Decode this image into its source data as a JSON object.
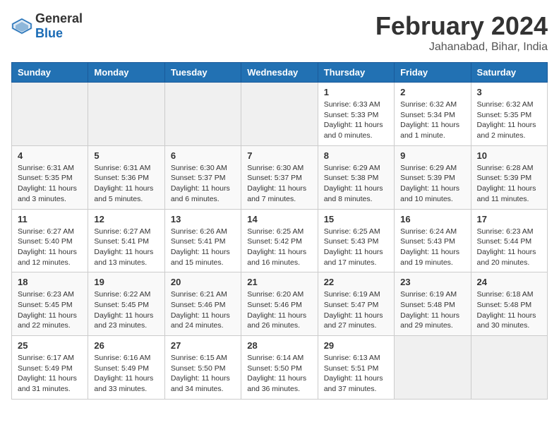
{
  "logo": {
    "general": "General",
    "blue": "Blue"
  },
  "title": {
    "month_year": "February 2024",
    "location": "Jahanabad, Bihar, India"
  },
  "weekdays": [
    "Sunday",
    "Monday",
    "Tuesday",
    "Wednesday",
    "Thursday",
    "Friday",
    "Saturday"
  ],
  "weeks": [
    [
      {
        "day": "",
        "info": ""
      },
      {
        "day": "",
        "info": ""
      },
      {
        "day": "",
        "info": ""
      },
      {
        "day": "",
        "info": ""
      },
      {
        "day": "1",
        "info": "Sunrise: 6:33 AM\nSunset: 5:33 PM\nDaylight: 11 hours\nand 0 minutes."
      },
      {
        "day": "2",
        "info": "Sunrise: 6:32 AM\nSunset: 5:34 PM\nDaylight: 11 hours\nand 1 minute."
      },
      {
        "day": "3",
        "info": "Sunrise: 6:32 AM\nSunset: 5:35 PM\nDaylight: 11 hours\nand 2 minutes."
      }
    ],
    [
      {
        "day": "4",
        "info": "Sunrise: 6:31 AM\nSunset: 5:35 PM\nDaylight: 11 hours\nand 3 minutes."
      },
      {
        "day": "5",
        "info": "Sunrise: 6:31 AM\nSunset: 5:36 PM\nDaylight: 11 hours\nand 5 minutes."
      },
      {
        "day": "6",
        "info": "Sunrise: 6:30 AM\nSunset: 5:37 PM\nDaylight: 11 hours\nand 6 minutes."
      },
      {
        "day": "7",
        "info": "Sunrise: 6:30 AM\nSunset: 5:37 PM\nDaylight: 11 hours\nand 7 minutes."
      },
      {
        "day": "8",
        "info": "Sunrise: 6:29 AM\nSunset: 5:38 PM\nDaylight: 11 hours\nand 8 minutes."
      },
      {
        "day": "9",
        "info": "Sunrise: 6:29 AM\nSunset: 5:39 PM\nDaylight: 11 hours\nand 10 minutes."
      },
      {
        "day": "10",
        "info": "Sunrise: 6:28 AM\nSunset: 5:39 PM\nDaylight: 11 hours\nand 11 minutes."
      }
    ],
    [
      {
        "day": "11",
        "info": "Sunrise: 6:27 AM\nSunset: 5:40 PM\nDaylight: 11 hours\nand 12 minutes."
      },
      {
        "day": "12",
        "info": "Sunrise: 6:27 AM\nSunset: 5:41 PM\nDaylight: 11 hours\nand 13 minutes."
      },
      {
        "day": "13",
        "info": "Sunrise: 6:26 AM\nSunset: 5:41 PM\nDaylight: 11 hours\nand 15 minutes."
      },
      {
        "day": "14",
        "info": "Sunrise: 6:25 AM\nSunset: 5:42 PM\nDaylight: 11 hours\nand 16 minutes."
      },
      {
        "day": "15",
        "info": "Sunrise: 6:25 AM\nSunset: 5:43 PM\nDaylight: 11 hours\nand 17 minutes."
      },
      {
        "day": "16",
        "info": "Sunrise: 6:24 AM\nSunset: 5:43 PM\nDaylight: 11 hours\nand 19 minutes."
      },
      {
        "day": "17",
        "info": "Sunrise: 6:23 AM\nSunset: 5:44 PM\nDaylight: 11 hours\nand 20 minutes."
      }
    ],
    [
      {
        "day": "18",
        "info": "Sunrise: 6:23 AM\nSunset: 5:45 PM\nDaylight: 11 hours\nand 22 minutes."
      },
      {
        "day": "19",
        "info": "Sunrise: 6:22 AM\nSunset: 5:45 PM\nDaylight: 11 hours\nand 23 minutes."
      },
      {
        "day": "20",
        "info": "Sunrise: 6:21 AM\nSunset: 5:46 PM\nDaylight: 11 hours\nand 24 minutes."
      },
      {
        "day": "21",
        "info": "Sunrise: 6:20 AM\nSunset: 5:46 PM\nDaylight: 11 hours\nand 26 minutes."
      },
      {
        "day": "22",
        "info": "Sunrise: 6:19 AM\nSunset: 5:47 PM\nDaylight: 11 hours\nand 27 minutes."
      },
      {
        "day": "23",
        "info": "Sunrise: 6:19 AM\nSunset: 5:48 PM\nDaylight: 11 hours\nand 29 minutes."
      },
      {
        "day": "24",
        "info": "Sunrise: 6:18 AM\nSunset: 5:48 PM\nDaylight: 11 hours\nand 30 minutes."
      }
    ],
    [
      {
        "day": "25",
        "info": "Sunrise: 6:17 AM\nSunset: 5:49 PM\nDaylight: 11 hours\nand 31 minutes."
      },
      {
        "day": "26",
        "info": "Sunrise: 6:16 AM\nSunset: 5:49 PM\nDaylight: 11 hours\nand 33 minutes."
      },
      {
        "day": "27",
        "info": "Sunrise: 6:15 AM\nSunset: 5:50 PM\nDaylight: 11 hours\nand 34 minutes."
      },
      {
        "day": "28",
        "info": "Sunrise: 6:14 AM\nSunset: 5:50 PM\nDaylight: 11 hours\nand 36 minutes."
      },
      {
        "day": "29",
        "info": "Sunrise: 6:13 AM\nSunset: 5:51 PM\nDaylight: 11 hours\nand 37 minutes."
      },
      {
        "day": "",
        "info": ""
      },
      {
        "day": "",
        "info": ""
      }
    ]
  ]
}
